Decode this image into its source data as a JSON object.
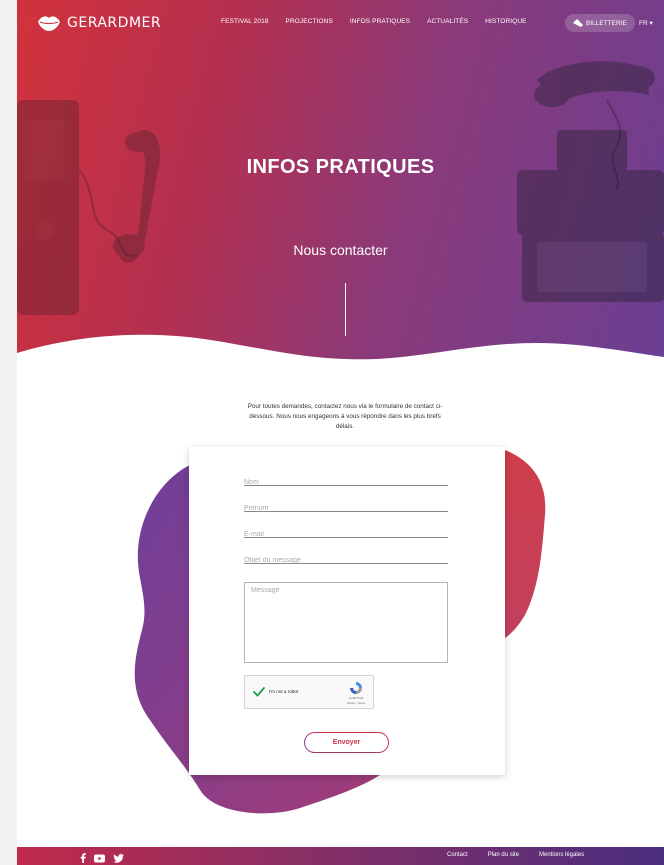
{
  "brand": {
    "name": "GERARDMER"
  },
  "nav": {
    "items": [
      {
        "label": "FESTIVAL 2018"
      },
      {
        "label": "PROJECTIONS"
      },
      {
        "label": "INFOS PRATIQUES"
      },
      {
        "label": "ACTUALITÉS"
      },
      {
        "label": "HISTORIQUE"
      }
    ],
    "ticket_label": "BILLETTERIE",
    "language": "FR ▾"
  },
  "hero": {
    "title": "INFOS PRATIQUES",
    "subtitle": "Nous contacter"
  },
  "intro": {
    "text": "Pour toutes demandes, contactez nous via le formulaire de contact ci-dessous. Nous nous engageons à vous répondre dans les plus brefs délais."
  },
  "form": {
    "fields": [
      {
        "placeholder": "Nom",
        "value": ""
      },
      {
        "placeholder": "Prénom",
        "value": ""
      },
      {
        "placeholder": "E-mail",
        "value": ""
      },
      {
        "placeholder": "Objet du message",
        "value": ""
      }
    ],
    "message_placeholder": "Message",
    "captcha": {
      "label": "I'm not a robot",
      "brand": "reCAPTCHA",
      "links": "Privacy - Terms",
      "checked": true
    },
    "submit_label": "Envoyer"
  },
  "footer": {
    "social": [
      "facebook-icon",
      "youtube-icon",
      "twitter-icon"
    ],
    "links": [
      {
        "label": "Contact"
      },
      {
        "label": "Plan du site"
      },
      {
        "label": "Mentions légales"
      }
    ]
  },
  "colors": {
    "accent_red": "#d2323c",
    "accent_purple": "#6a3f93",
    "submit_text": "#c7344b"
  }
}
